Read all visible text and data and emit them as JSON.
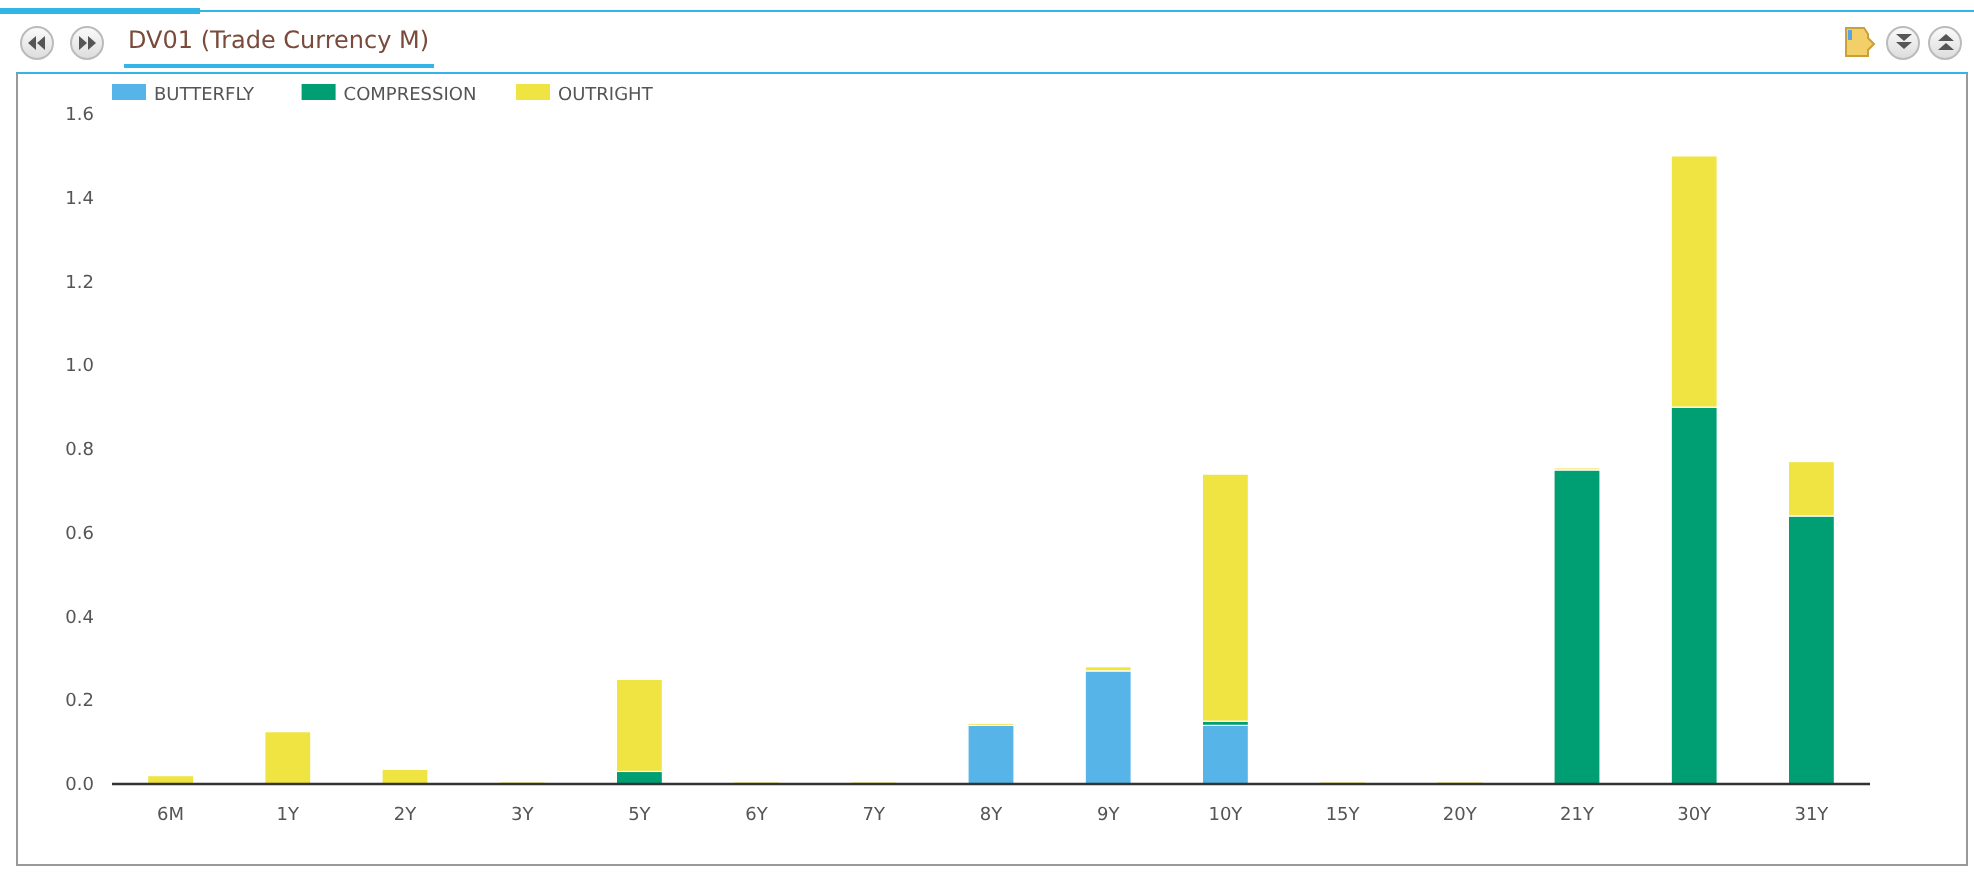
{
  "tab": {
    "title": "DV01 (Trade Currency M)",
    "selected": true
  },
  "chart": {
    "chart_data": {
      "type": "bar",
      "stacked": true,
      "legend": "top-left",
      "categories": [
        "6M",
        "1Y",
        "2Y",
        "3Y",
        "5Y",
        "6Y",
        "7Y",
        "8Y",
        "9Y",
        "10Y",
        "15Y",
        "20Y",
        "21Y",
        "30Y",
        "31Y"
      ],
      "series": [
        {
          "name": "BUTTERFLY",
          "color": "#56b4e9",
          "values": [
            0,
            0,
            0,
            0,
            0,
            0,
            0,
            0.14,
            0.27,
            0.14,
            0,
            0,
            0,
            0,
            0
          ]
        },
        {
          "name": "COMPRESSION",
          "color": "#009e73",
          "values": [
            0,
            0,
            0,
            0,
            0.03,
            0,
            0,
            0,
            0,
            0.01,
            0,
            0,
            0.75,
            0.9,
            0.64
          ]
        },
        {
          "name": "OUTRIGHT",
          "color": "#f0e442",
          "values": [
            0.02,
            0.125,
            0.035,
            0.005,
            0.22,
            0.005,
            0.005,
            0.005,
            0.01,
            0.59,
            0.005,
            0.005,
            0.005,
            0.6,
            0.13
          ]
        }
      ],
      "ylim": [
        0,
        1.6
      ],
      "yticks": [
        {
          "value": 0,
          "label": "0.0"
        },
        {
          "value": 0.2,
          "label": "0.2"
        },
        {
          "value": 0.4,
          "label": "0.4"
        },
        {
          "value": 0.6,
          "label": "0.6"
        },
        {
          "value": 0.8,
          "label": "0.8"
        },
        {
          "value": 1.0,
          "label": "1.0"
        },
        {
          "value": 1.2,
          "label": "1.2"
        },
        {
          "value": 1.4,
          "label": "1.4"
        },
        {
          "value": 1.6,
          "label": "1.6"
        }
      ]
    }
  }
}
